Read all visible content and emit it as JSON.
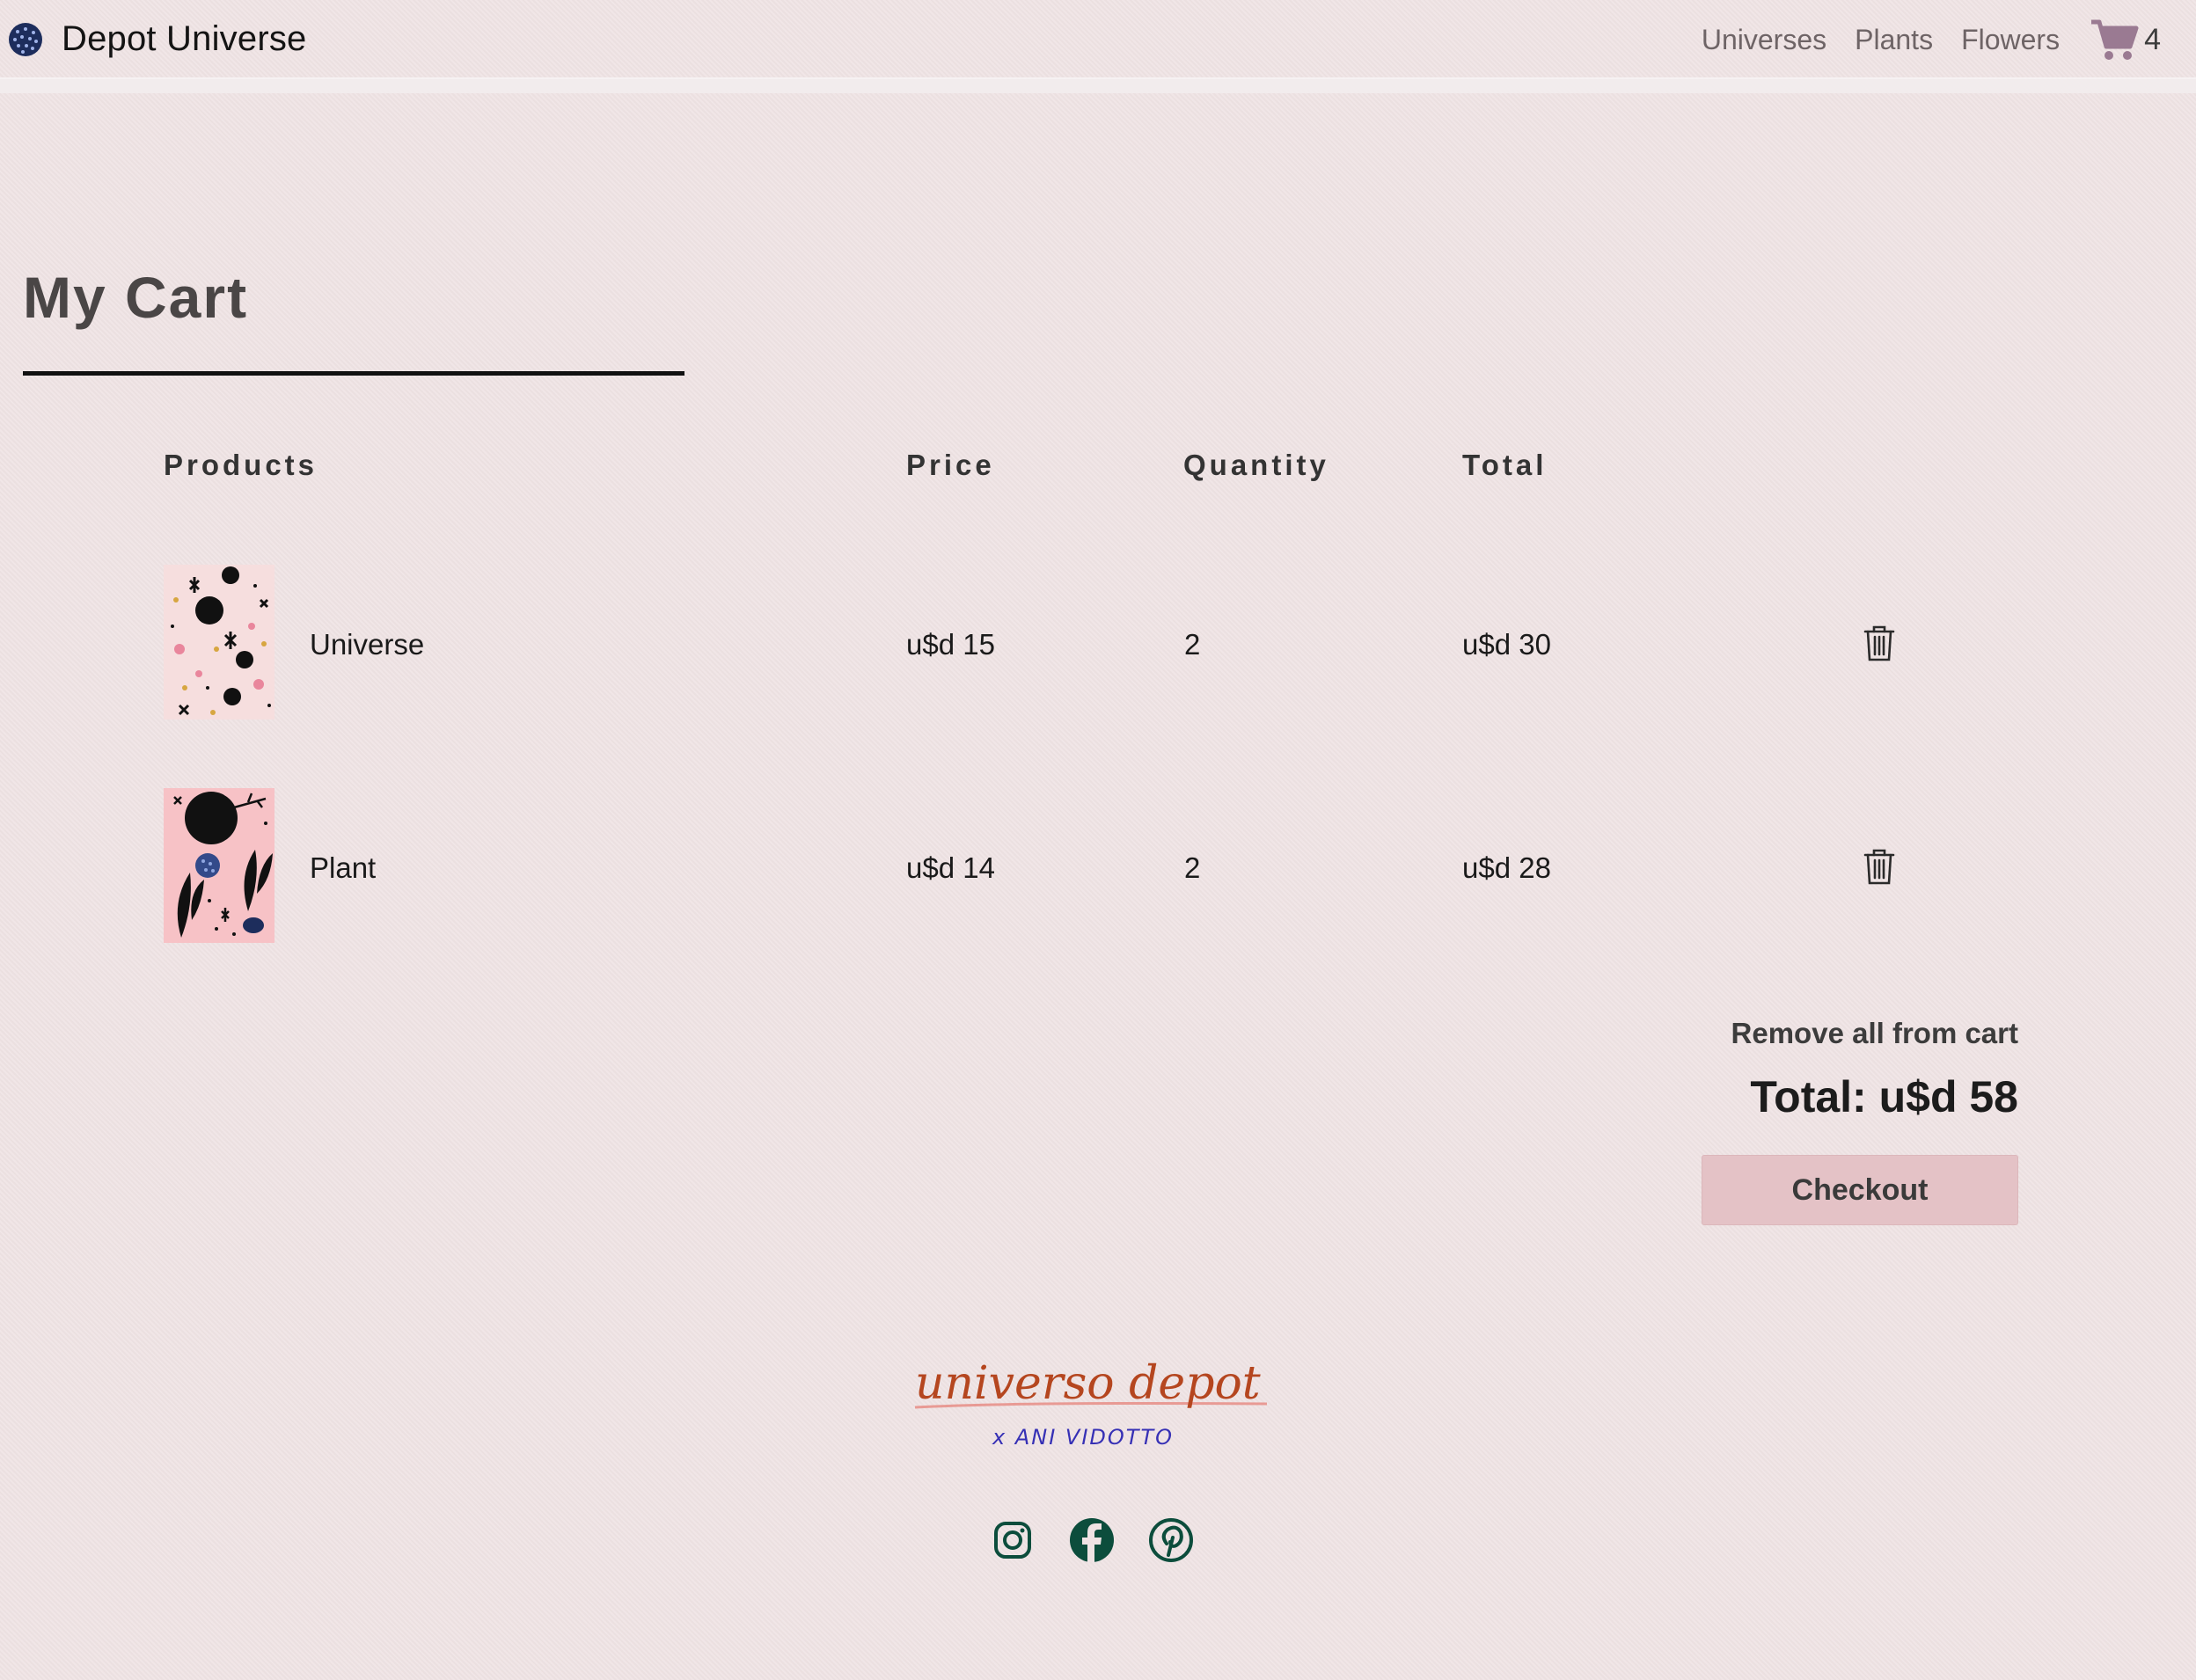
{
  "navbar": {
    "brand": "Depot Universe",
    "links": [
      "Universes",
      "Plants",
      "Flowers"
    ],
    "cart_count": "4"
  },
  "cart": {
    "title": "My Cart",
    "headers": {
      "products": "Products",
      "price": "Price",
      "quantity": "Quantity",
      "total": "Total"
    },
    "items": [
      {
        "name": "Universe",
        "price": "u$d 15",
        "quantity": "2",
        "total": "u$d 30"
      },
      {
        "name": "Plant",
        "price": "u$d 14",
        "quantity": "2",
        "total": "u$d 28"
      }
    ],
    "remove_all_label": "Remove all from cart",
    "grand_total": "Total: u$d 58",
    "checkout_label": "Checkout"
  },
  "footer": {
    "logo_text": "universo depot",
    "logo_subtext": "x ANI VIDOTTO",
    "social_icons": [
      "instagram-icon",
      "facebook-icon",
      "pinterest-icon"
    ]
  },
  "colors": {
    "background": "#efe3e4",
    "checkout_button": "#e4c2c6",
    "cart_icon": "#9a7a92",
    "footer_logo_main": "#b5461f",
    "footer_logo_sub": "#3630b5",
    "social_icons": "#0c4d3c"
  }
}
